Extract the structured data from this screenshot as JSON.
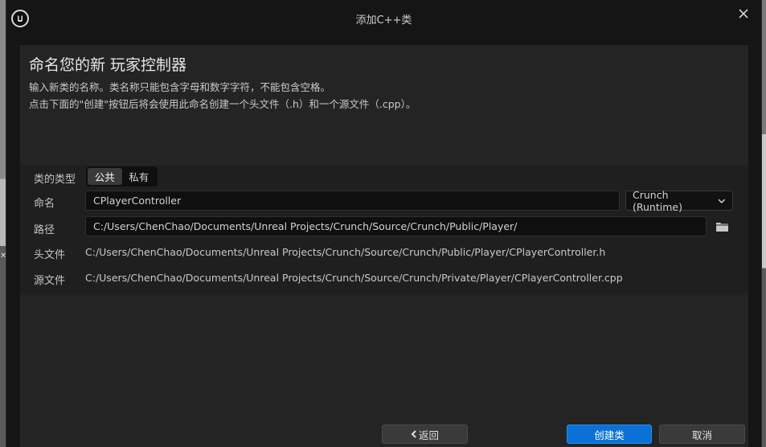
{
  "window": {
    "title": "添加C++类"
  },
  "header": {
    "heading": "命名您的新 玩家控制器",
    "description_line1": "输入新类的名称。类名称只能包含字母和数字字符，不能包含空格。",
    "description_line2": "点击下面的\"创建\"按钮后将会使用此命名创建一个头文件（.h）和一个源文件（.cpp）。"
  },
  "form": {
    "class_type": {
      "label": "类的类型",
      "options": [
        "公共",
        "私有"
      ],
      "selected": "公共"
    },
    "name": {
      "label": "命名",
      "value": "CPlayerController"
    },
    "module": {
      "value": "Crunch (Runtime)"
    },
    "path": {
      "label": "路径",
      "value": "C:/Users/ChenChao/Documents/Unreal Projects/Crunch/Source/Crunch/Public/Player/"
    },
    "header_file": {
      "label": "头文件",
      "value": "C:/Users/ChenChao/Documents/Unreal Projects/Crunch/Source/Crunch/Public/Player/CPlayerController.h"
    },
    "source_file": {
      "label": "源文件",
      "value": "C:/Users/ChenChao/Documents/Unreal Projects/Crunch/Source/Crunch/Private/Player/CPlayerController.cpp"
    }
  },
  "buttons": {
    "back": "返回",
    "create": "创建类",
    "cancel": "取消"
  },
  "icons": {
    "logo": "unreal-engine-logo",
    "close": "close-icon",
    "chevron": "chevron-down-icon",
    "folder": "folder-icon",
    "back": "chevron-left-icon"
  },
  "colors": {
    "accent": "#0a72d7",
    "dialog_bg": "#151515",
    "panel_bg": "#242424"
  }
}
